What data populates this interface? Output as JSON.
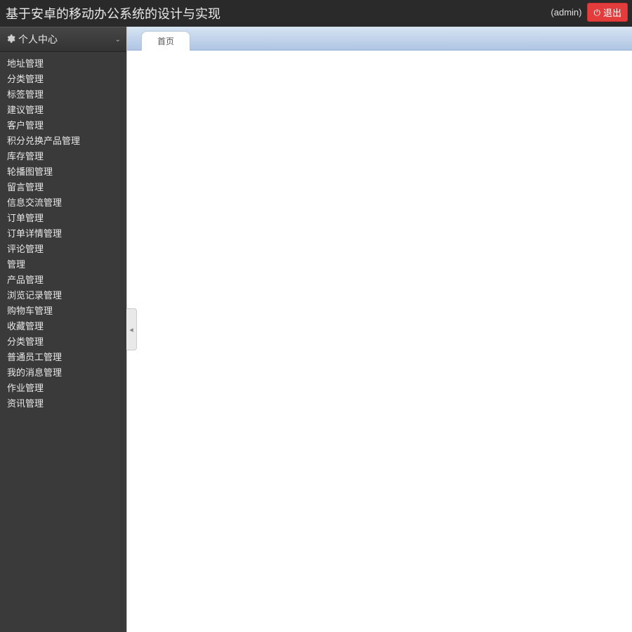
{
  "header": {
    "title": "基于安卓的移动办公系统的设计与实现",
    "user": "(admin)",
    "logout_label": "退出"
  },
  "sidebar": {
    "accordion_title": "个人中心",
    "items": [
      {
        "label": "地址管理"
      },
      {
        "label": "分类管理"
      },
      {
        "label": "标签管理"
      },
      {
        "label": "建议管理"
      },
      {
        "label": "客户管理"
      },
      {
        "label": "积分兑换产品管理"
      },
      {
        "label": "库存管理"
      },
      {
        "label": "轮播图管理"
      },
      {
        "label": "留言管理"
      },
      {
        "label": "信息交流管理"
      },
      {
        "label": "订单管理"
      },
      {
        "label": "订单详情管理"
      },
      {
        "label": "评论管理"
      },
      {
        "label": "管理"
      },
      {
        "label": "产品管理"
      },
      {
        "label": "浏览记录管理"
      },
      {
        "label": "购物车管理"
      },
      {
        "label": "收藏管理"
      },
      {
        "label": "分类管理"
      },
      {
        "label": "普通员工管理"
      },
      {
        "label": "我的消息管理"
      },
      {
        "label": "作业管理"
      },
      {
        "label": "资讯管理"
      }
    ]
  },
  "tabs": {
    "active": "首页"
  }
}
